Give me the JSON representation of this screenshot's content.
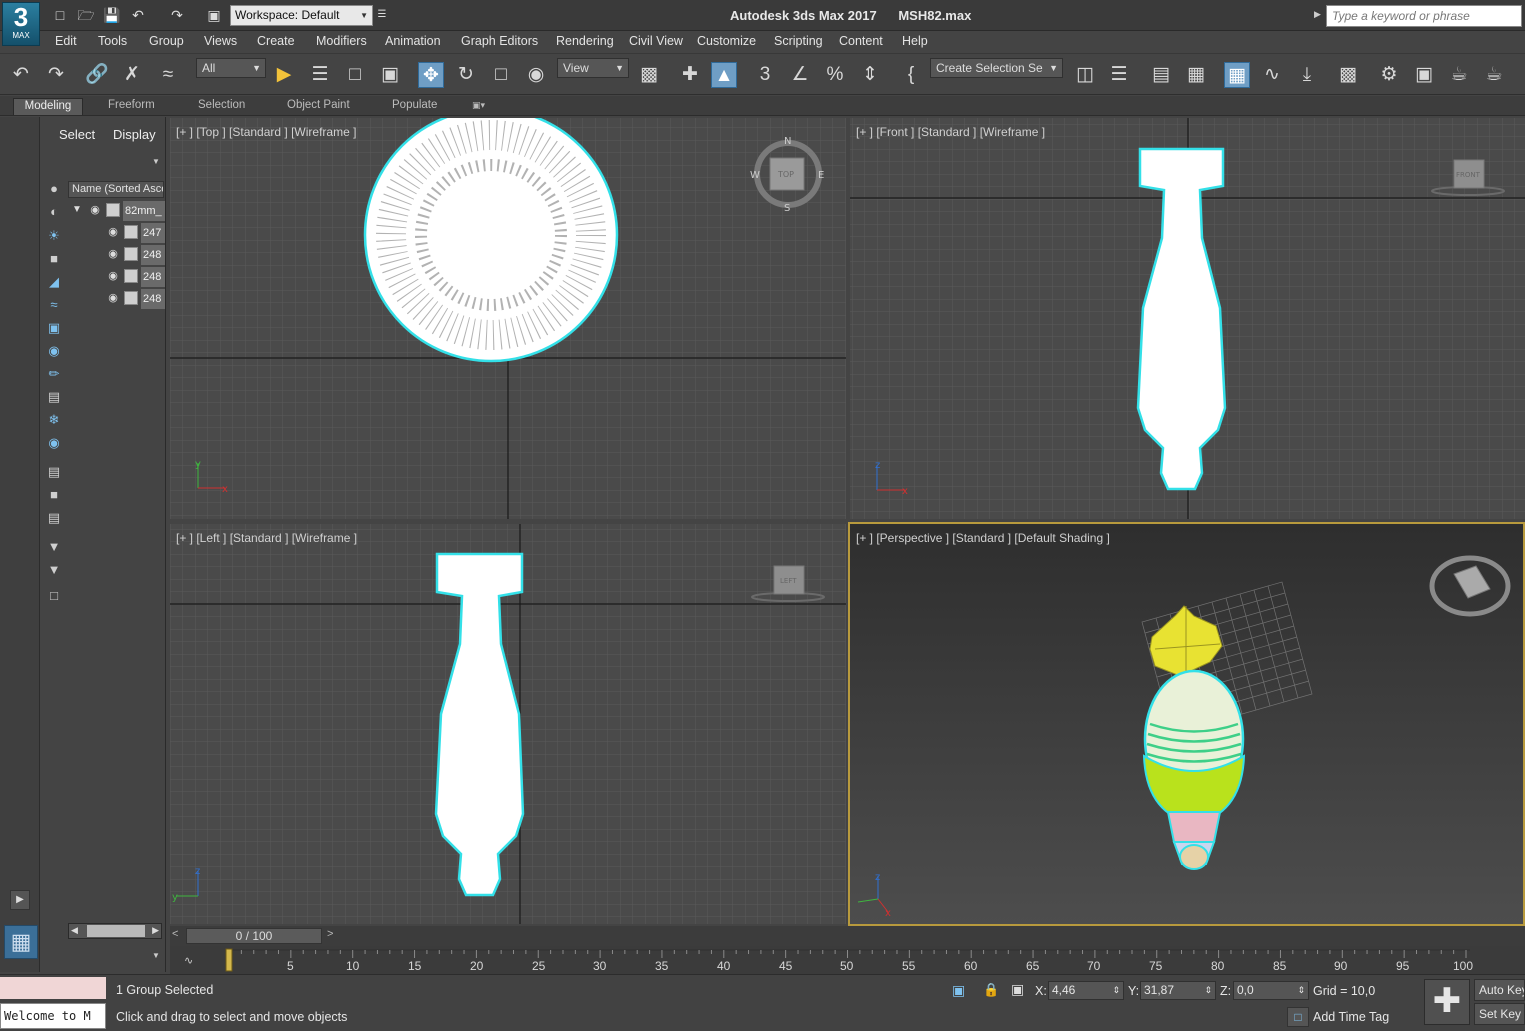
{
  "title_bar": {
    "app_logo_main": "3",
    "app_logo_sub": "MAX",
    "workspace": "Workspace: Default",
    "title": "Autodesk 3ds Max 2017      MSH82.max",
    "search_placeholder": "Type a keyword or phrase"
  },
  "menu": [
    "Edit",
    "Tools",
    "Group",
    "Views",
    "Create",
    "Modifiers",
    "Animation",
    "Graph Editors",
    "Rendering",
    "Civil View",
    "Customize",
    "Scripting",
    "Content",
    "Help"
  ],
  "toolbar": {
    "selection_filter": "All",
    "reference_coord": "View",
    "selection_set": "Create Selection Se"
  },
  "ribbon_tabs": [
    "Modeling",
    "Freeform",
    "Selection",
    "Object Paint",
    "Populate"
  ],
  "scene_explorer": {
    "tabs": [
      "Select",
      "Display"
    ],
    "column_header": "Name (Sorted Asce",
    "group_name": "82mm_",
    "children": [
      "247",
      "248",
      "248",
      "248"
    ]
  },
  "viewports": {
    "top": "[+ ] [Top ] [Standard ] [Wireframe ]",
    "front": "[+ ] [Front ] [Standard ] [Wireframe ]",
    "left": "[+ ] [Left ] [Standard ] [Wireframe ]",
    "perspective": "[+ ] [Perspective ] [Standard ] [Default Shading ]",
    "viewcube_top": "TOP",
    "viewcube_front": "FRONT",
    "viewcube_left": "LEFT",
    "compass": {
      "n": "N",
      "s": "S",
      "e": "E",
      "w": "W"
    }
  },
  "timeline": {
    "frame": "0 / 100",
    "ticks": [
      "5",
      "10",
      "15",
      "20",
      "25",
      "30",
      "35",
      "40",
      "45",
      "50",
      "55",
      "60",
      "65",
      "70",
      "75",
      "80",
      "85",
      "90",
      "95",
      "100"
    ]
  },
  "status": {
    "maxscript": "Welcome to M",
    "selection": "1 Group Selected",
    "prompt": "Click and drag to select and move objects",
    "x_label": "X:",
    "x_value": "4,46",
    "y_label": "Y:",
    "y_value": "31,87",
    "z_label": "Z:",
    "z_value": "0,0",
    "grid": "Grid = 10,0",
    "add_time_tag": "Add Time Tag",
    "auto_key": "Auto Key",
    "set_key": "Set Key"
  },
  "colors": {
    "accent_blue": "#6f9ec5",
    "selection_cyan": "#33e0e8",
    "active_viewport_border": "#b89a3d",
    "mortar_body_green": "#b9e21c",
    "mortar_fins_yellow": "#e8e232"
  }
}
